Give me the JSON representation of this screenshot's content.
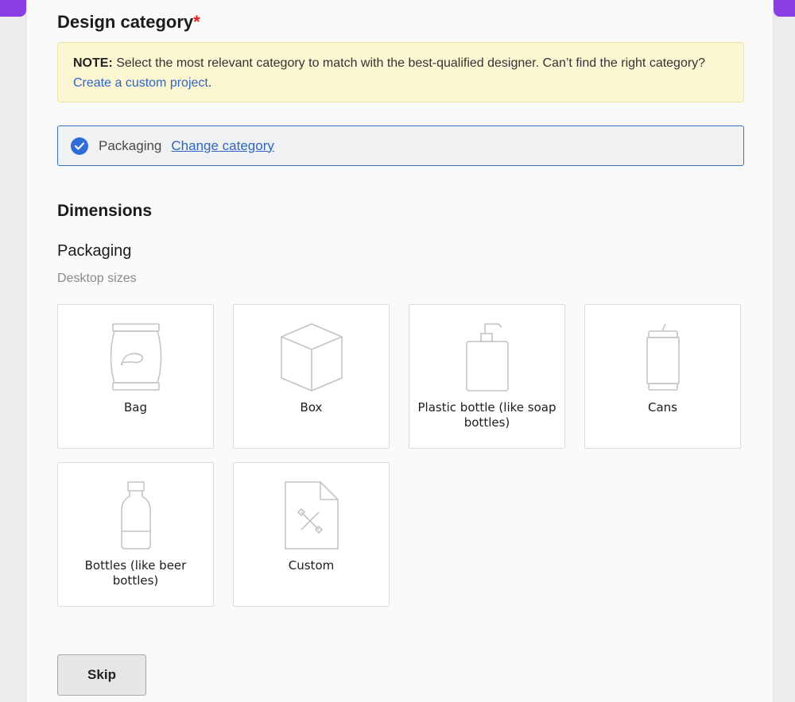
{
  "header": {
    "title": "Design category",
    "required_mark": "*"
  },
  "note": {
    "label": "NOTE:",
    "text": " Select the most relevant category to match with the best-qualified designer. Can’t find the right category? ",
    "link": "Create a custom project",
    "suffix": "."
  },
  "selected_category": {
    "value": "Packaging",
    "change_link": "Change category"
  },
  "dimensions": {
    "title": "Dimensions",
    "group_title": "Packaging",
    "group_subtitle": "Desktop sizes",
    "options": [
      {
        "label": "Bag",
        "icon": "bag-icon"
      },
      {
        "label": "Box",
        "icon": "box-icon"
      },
      {
        "label": "Plastic bottle (like soap bottles)",
        "icon": "pump-bottle-icon"
      },
      {
        "label": "Cans",
        "icon": "can-icon"
      },
      {
        "label": "Bottles (like beer bottles)",
        "icon": "bottle-icon"
      },
      {
        "label": "Custom",
        "icon": "custom-file-icon"
      }
    ]
  },
  "actions": {
    "skip_label": "Skip"
  },
  "colors": {
    "accent": "#8c3ee6",
    "link": "#2e65c4",
    "note_bg": "#fcf6d3",
    "check": "#2f6dd8"
  }
}
